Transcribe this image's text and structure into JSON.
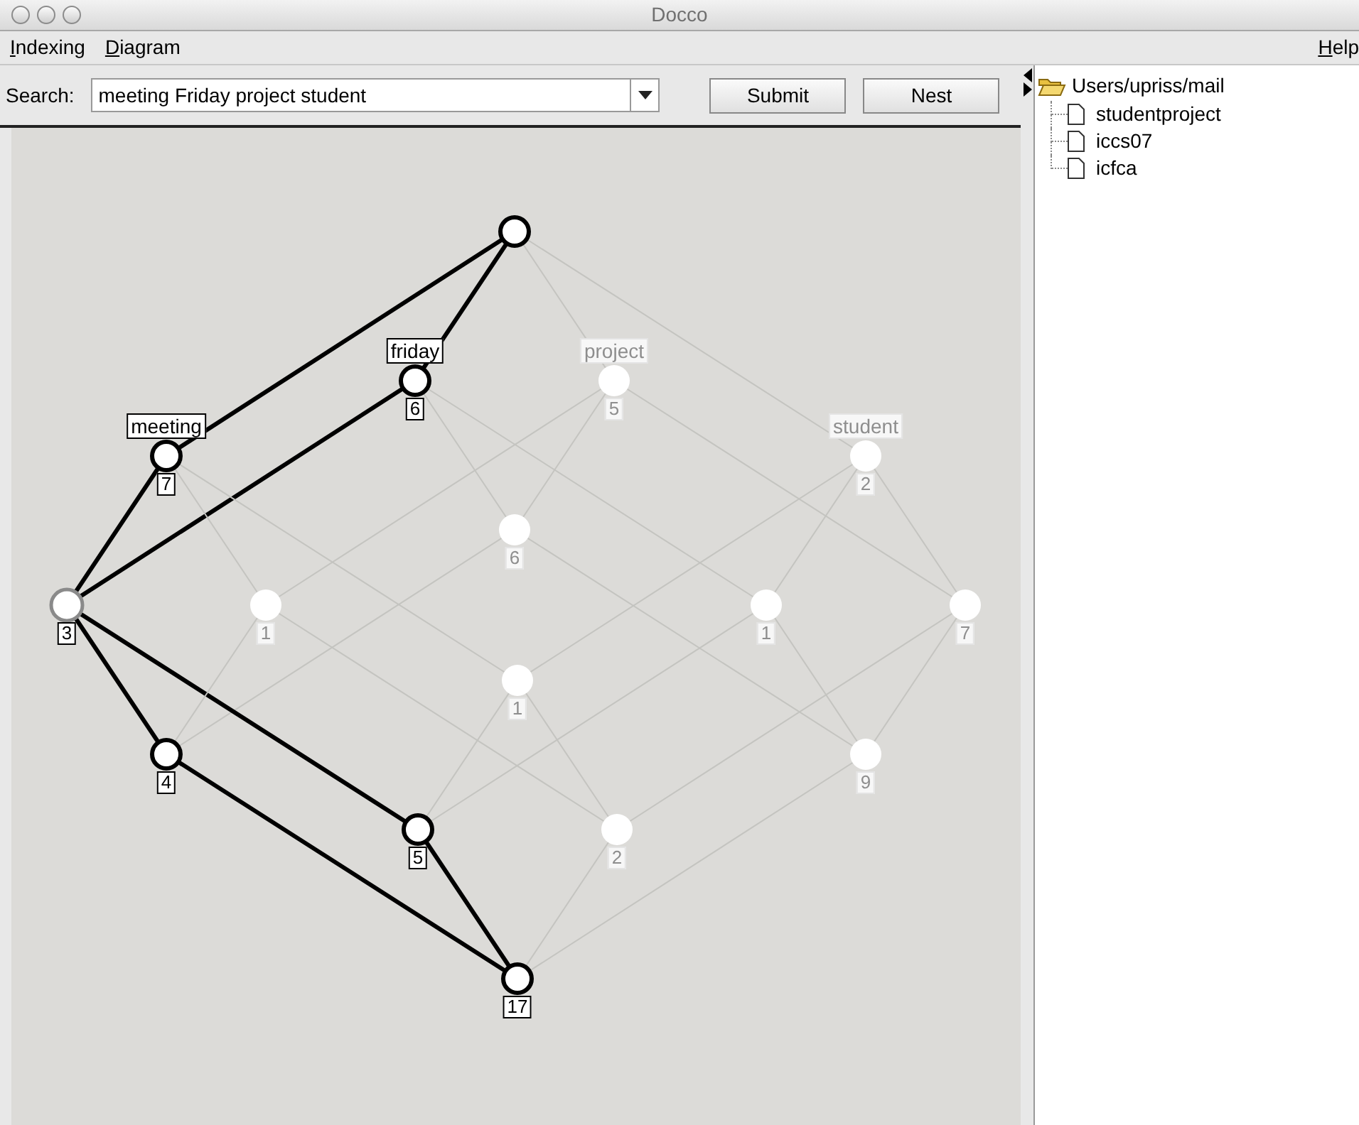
{
  "window": {
    "title": "Docco"
  },
  "menu": [
    "Indexing",
    "Diagram"
  ],
  "help_menu": "Help",
  "search": {
    "label": "Search:",
    "value": "meeting Friday project student",
    "buttons": [
      "Submit",
      "Nest"
    ]
  },
  "diagram": {
    "nodes": [
      {
        "highlighted": true,
        "selected": false
      },
      {
        "label": "friday",
        "count": "6",
        "highlighted": true,
        "selected": false
      },
      {
        "label": "project",
        "count": "5",
        "highlighted": false,
        "selected": false
      },
      {
        "label": "meeting",
        "count": "7",
        "highlighted": true,
        "selected": false
      },
      {
        "label": "student",
        "count": "2",
        "highlighted": false,
        "selected": false
      },
      {
        "count": "6",
        "highlighted": false,
        "selected": false
      },
      {
        "count": "3",
        "highlighted": false,
        "selected": true
      },
      {
        "count": "1",
        "highlighted": false,
        "selected": false
      },
      {
        "count": "1",
        "highlighted": false,
        "selected": false
      },
      {
        "count": "7",
        "highlighted": false,
        "selected": false
      },
      {
        "count": "1",
        "highlighted": false,
        "selected": false
      },
      {
        "count": "4",
        "highlighted": true,
        "selected": false
      },
      {
        "count": "9",
        "highlighted": false,
        "selected": false
      },
      {
        "count": "5",
        "highlighted": true,
        "selected": false
      },
      {
        "count": "2",
        "highlighted": false,
        "selected": false
      },
      {
        "count": "17",
        "highlighted": true,
        "selected": false
      }
    ]
  },
  "tree": {
    "label": "Users/upriss/mail",
    "expanded": true,
    "children": [
      {
        "label": "studentproject"
      },
      {
        "label": "iccs07"
      },
      {
        "label": "icfca"
      }
    ]
  }
}
